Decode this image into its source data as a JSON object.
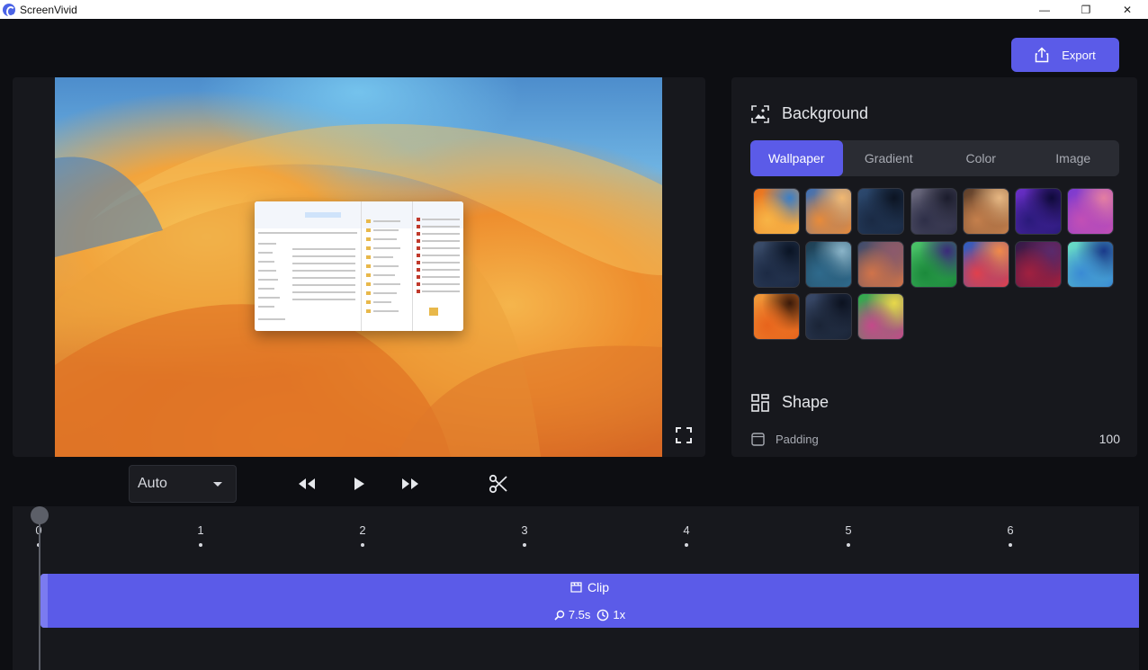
{
  "window": {
    "title": "ScreenVivid",
    "minimize_glyph": "—",
    "restore_glyph": "❐",
    "close_glyph": "✕"
  },
  "toolbar": {
    "export_label": "Export"
  },
  "background": {
    "title": "Background",
    "tabs": [
      {
        "label": "Wallpaper",
        "active": true
      },
      {
        "label": "Gradient",
        "active": false
      },
      {
        "label": "Color",
        "active": false
      },
      {
        "label": "Image",
        "active": false
      }
    ],
    "wallpapers": [
      {
        "name": "macos-ventura-orange",
        "colors": [
          "#f7b446",
          "#e86f1d",
          "#3c7fc6"
        ]
      },
      {
        "name": "macos-ventura-blue-orange",
        "colors": [
          "#e88b3a",
          "#3b6fb7",
          "#f1b872"
        ]
      },
      {
        "name": "macos-catalina-night",
        "colors": [
          "#1a2a44",
          "#2d4a70",
          "#0c1422"
        ]
      },
      {
        "name": "macos-catalina-dusk",
        "colors": [
          "#2e2f48",
          "#6c6a7e",
          "#1b1c2c"
        ]
      },
      {
        "name": "macos-mojave-day",
        "colors": [
          "#c47f4c",
          "#5c3e2a",
          "#e6b783"
        ]
      },
      {
        "name": "macos-bigsur-purple",
        "colors": [
          "#2a1a7a",
          "#6b2fc9",
          "#0f0a3a"
        ]
      },
      {
        "name": "macos-monterey-pink",
        "colors": [
          "#c24fb5",
          "#7a3ad1",
          "#e47ea2"
        ]
      },
      {
        "name": "macos-bigsur-island-night",
        "colors": [
          "#1c2a44",
          "#3c4e6c",
          "#0a1424"
        ]
      },
      {
        "name": "macos-bigsur-island-day",
        "colors": [
          "#2f6a8c",
          "#1e3e52",
          "#8ab4c8"
        ]
      },
      {
        "name": "macos-sierra-mountain",
        "colors": [
          "#d0734a",
          "#3a4a6e",
          "#8c5a6c"
        ]
      },
      {
        "name": "macos-sonoma-green",
        "colors": [
          "#1c8a3c",
          "#4cc46a",
          "#3a2a7a"
        ]
      },
      {
        "name": "macos-bigsur-red-blue",
        "colors": [
          "#e0404c",
          "#2a5ec4",
          "#f08a4a"
        ]
      },
      {
        "name": "macos-bigsur-dark-red",
        "colors": [
          "#a02040",
          "#301a4a",
          "#5a2a6c"
        ]
      },
      {
        "name": "macos-monterey-blue",
        "colors": [
          "#3a8ad4",
          "#6ae0c4",
          "#1a3a8a"
        ]
      },
      {
        "name": "macos-ventura-dark-orange",
        "colors": [
          "#e8641c",
          "#f09a3a",
          "#3a1a0a"
        ]
      },
      {
        "name": "macos-mojave-night",
        "colors": [
          "#1a2436",
          "#3a4a6a",
          "#0c1220"
        ]
      },
      {
        "name": "macos-sonoma-hills",
        "colors": [
          "#c44a8a",
          "#2ab04a",
          "#e8d84a"
        ]
      }
    ]
  },
  "shape": {
    "title": "Shape",
    "padding_label": "Padding",
    "padding_value": "100"
  },
  "playback": {
    "speed_value": "Auto"
  },
  "timeline": {
    "ticks": [
      "0",
      "1",
      "2",
      "3",
      "4",
      "5",
      "6"
    ],
    "clip_label": "Clip",
    "clip_duration": "7.5s",
    "clip_speed": "1x"
  },
  "colors": {
    "accent": "#5b5be8",
    "panel": "#17181d",
    "background": "#0d0e12"
  }
}
